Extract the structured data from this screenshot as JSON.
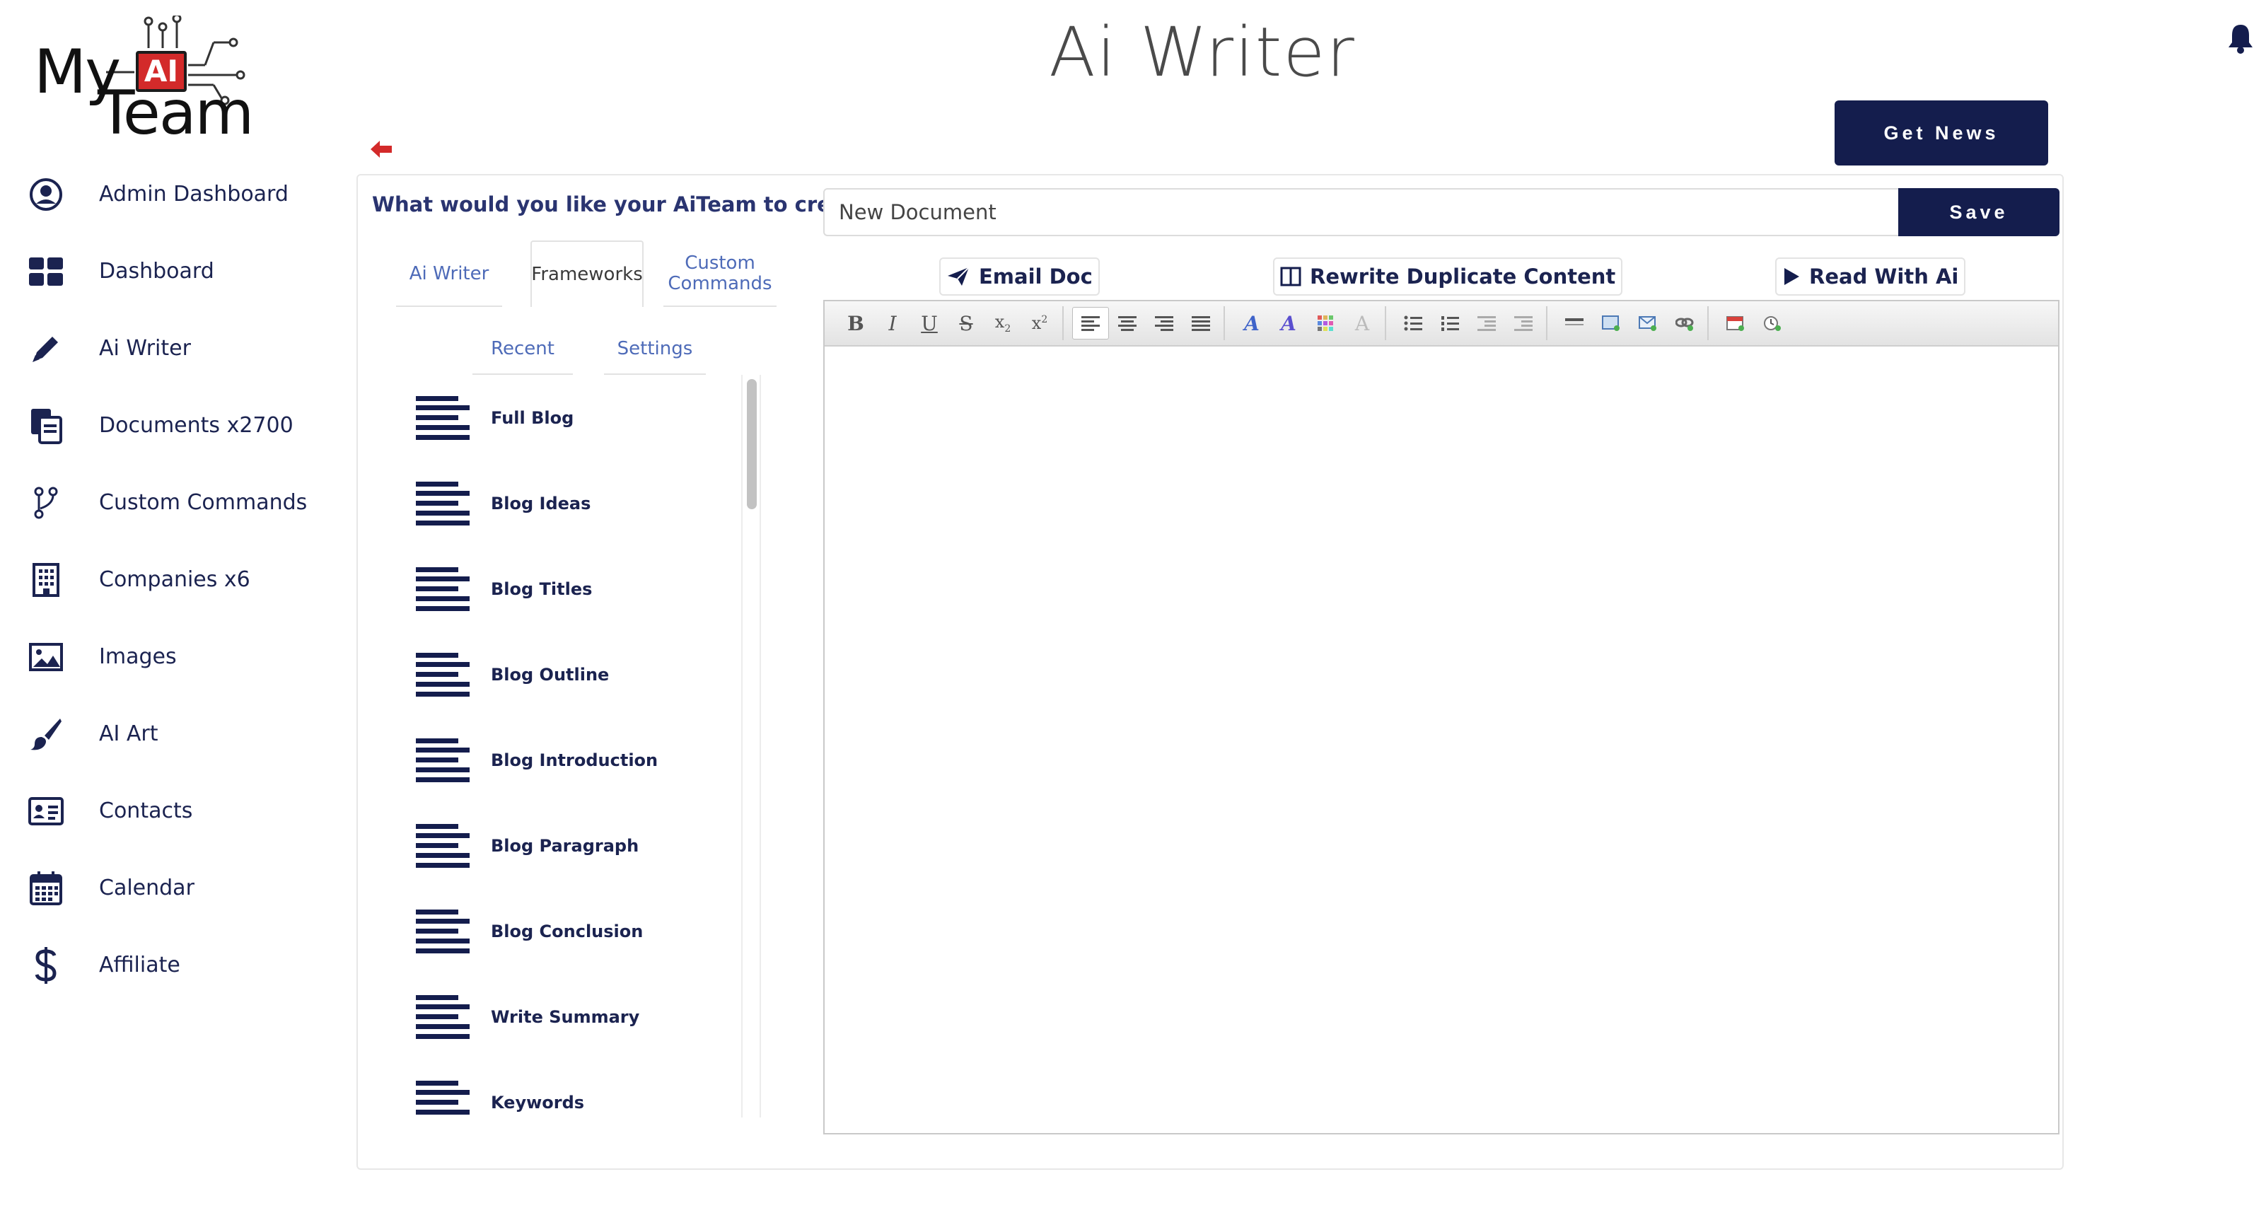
{
  "brand": {
    "my": "My",
    "ai": "AI",
    "team": "Team"
  },
  "header": {
    "title": "Ai Writer",
    "get_news": "Get News"
  },
  "sidebar": {
    "items": [
      {
        "label": "Admin Dashboard",
        "icon": "user-circle-icon"
      },
      {
        "label": "Dashboard",
        "icon": "grid-icon"
      },
      {
        "label": "Ai Writer",
        "icon": "pencil-icon"
      },
      {
        "label": "Documents x2700",
        "icon": "documents-icon"
      },
      {
        "label": "Custom Commands",
        "icon": "branch-icon"
      },
      {
        "label": "Companies x6",
        "icon": "building-icon"
      },
      {
        "label": "Images",
        "icon": "image-icon"
      },
      {
        "label": "AI Art",
        "icon": "paintbrush-icon"
      },
      {
        "label": "Contacts",
        "icon": "contact-card-icon"
      },
      {
        "label": "Calendar",
        "icon": "calendar-icon"
      },
      {
        "label": "Affiliate",
        "icon": "dollar-icon"
      }
    ]
  },
  "main": {
    "question": "What would you like your AiTeam to create?",
    "tabs": [
      "Ai Writer",
      "Frameworks",
      "Custom Commands"
    ],
    "subtabs": [
      "Recent",
      "Settings"
    ],
    "frameworks": [
      "Full Blog",
      "Blog Ideas",
      "Blog Titles",
      "Blog Outline",
      "Blog Introduction",
      "Blog Paragraph",
      "Blog Conclusion",
      "Write Summary",
      "Keywords"
    ],
    "document_title": "New Document",
    "save": "Save",
    "actions": {
      "email": "Email Doc",
      "rewrite": "Rewrite Duplicate Content",
      "read": "Read With Ai"
    }
  },
  "colors": {
    "navy": "#141d4d",
    "accent_red": "#d32a2a",
    "link_blue": "#4e6bb8"
  }
}
